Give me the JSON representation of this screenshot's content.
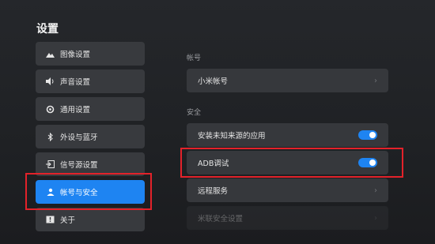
{
  "page": {
    "title": "设置"
  },
  "sidebar": {
    "items": [
      {
        "label": "图像设置",
        "icon": "image-icon"
      },
      {
        "label": "声音设置",
        "icon": "speaker-icon"
      },
      {
        "label": "通用设置",
        "icon": "gear-icon"
      },
      {
        "label": "外设与蓝牙",
        "icon": "bluetooth-icon"
      },
      {
        "label": "信号源设置",
        "icon": "input-source-icon"
      },
      {
        "label": "帐号与安全",
        "icon": "user-icon",
        "active": true
      },
      {
        "label": "关于",
        "icon": "info-icon"
      }
    ]
  },
  "main": {
    "account_section": "帐号",
    "account_row": "小米帐号",
    "security_section": "安全",
    "rows": [
      {
        "label": "安装未知来源的应用",
        "type": "toggle",
        "on": true
      },
      {
        "label": "ADB调试",
        "type": "toggle",
        "on": true
      },
      {
        "label": "远程服务",
        "type": "link"
      },
      {
        "label": "米联安全设置",
        "type": "link"
      }
    ]
  },
  "colors": {
    "accent": "#1e84f2",
    "highlight_box": "#e3222a"
  }
}
